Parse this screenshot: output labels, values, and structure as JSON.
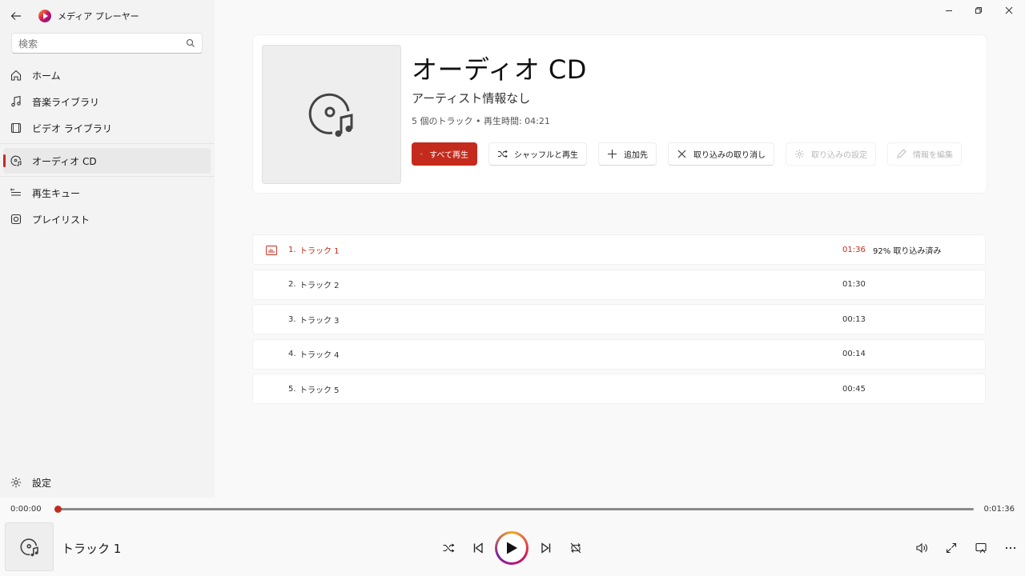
{
  "app": {
    "title": "メディア プレーヤー"
  },
  "search": {
    "placeholder": "検索"
  },
  "sidebar": {
    "items": [
      {
        "label": "ホーム",
        "icon": "home-icon"
      },
      {
        "label": "音楽ライブラリ",
        "icon": "music-note-icon"
      },
      {
        "label": "ビデオ ライブラリ",
        "icon": "film-icon"
      },
      {
        "label": "オーディオ CD",
        "icon": "cd-icon",
        "active": true
      },
      {
        "label": "再生キュー",
        "icon": "queue-icon"
      },
      {
        "label": "プレイリスト",
        "icon": "playlist-icon"
      }
    ],
    "settings_label": "設定"
  },
  "album": {
    "title": "オーディオ CD",
    "artist": "アーティスト情報なし",
    "meta": "5 個のトラック • 再生時間: 04:21"
  },
  "actions": {
    "play_all": "すべて再生",
    "shuffle_play": "シャッフルと再生",
    "add_to": "追加先",
    "cancel_rip": "取り込みの取り消し",
    "rip_settings": "取り込みの設定",
    "edit_info": "情報を編集"
  },
  "tracks": [
    {
      "num": "1.",
      "title": "トラック 1",
      "duration": "01:36",
      "status": "92% 取り込み済み",
      "playing": true
    },
    {
      "num": "2.",
      "title": "トラック 2",
      "duration": "01:30",
      "status": ""
    },
    {
      "num": "3.",
      "title": "トラック 3",
      "duration": "00:13",
      "status": ""
    },
    {
      "num": "4.",
      "title": "トラック 4",
      "duration": "00:14",
      "status": ""
    },
    {
      "num": "5.",
      "title": "トラック 5",
      "duration": "00:45",
      "status": ""
    }
  ],
  "player": {
    "elapsed": "0:00:00",
    "total": "0:01:36",
    "progress": 0,
    "now_playing_title": "トラック 1"
  },
  "colors": {
    "accent": "#c42b1c"
  }
}
